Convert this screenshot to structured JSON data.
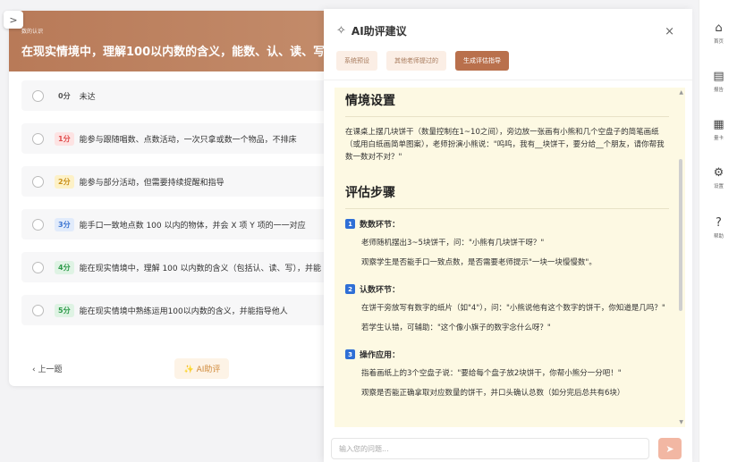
{
  "left_panel": {
    "collapse_glyph": ">",
    "breadcrumb": "数的认识",
    "title": "在现实情境中，理解100以内数的含义，能数、认、读、写",
    "options": [
      {
        "score": "0分",
        "text": "未达"
      },
      {
        "score": "1分",
        "text": "能参与跟随唱数、点数活动，一次只拿或数一个物品，不排床"
      },
      {
        "score": "2分",
        "text": "能参与部分活动，但需要持续提醒和指导"
      },
      {
        "score": "3分",
        "text": "能手口一致地点数 100 以内的物体，并会 X 项 Y 项的一一对应"
      },
      {
        "score": "4分",
        "text": "能在现实情境中，理解 100 以内数的含义（包括认、读、写），并能"
      },
      {
        "score": "5分",
        "text": "能在现实情境中熟练运用100以内数的含义，并能指导他人"
      }
    ],
    "prev_label": "上一题",
    "ai_button_label": "AI助评"
  },
  "drawer": {
    "title": "AI助评建议",
    "close_glyph": "×",
    "tabs": [
      {
        "label": "系统预设",
        "active": false
      },
      {
        "label": "其他老师提过的",
        "active": false
      },
      {
        "label": "生成评估指导",
        "active": true
      }
    ],
    "content": {
      "heading1": "情境设置",
      "scenario": "在课桌上摆几块饼干（数量控制在1~10之间），旁边放一张画有小熊和几个空盘子的简笔画纸（或用白纸画简单图案），老师扮演小熊说：\"呜呜，我有__块饼干，要分给__个朋友，请你帮我数一数对不对？\"",
      "heading2": "评估步骤",
      "steps": [
        {
          "num": "1",
          "title": "数数环节：",
          "lines": [
            "老师随机摆出3~5块饼干，问：\"小熊有几块饼干呀？\"",
            "观察学生是否能手口一致点数，是否需要老师提示\"一块一块慢慢数\"。"
          ]
        },
        {
          "num": "2",
          "title": "认数环节：",
          "lines": [
            "在饼干旁放写有数字的纸片（如\"4\"），问：\"小熊说他有这个数字的饼干，你知道是几吗？\"",
            "若学生认错，可辅助：\"这个像小旗子的数字念什么呀？\""
          ]
        },
        {
          "num": "3",
          "title": "操作应用：",
          "lines": [
            "指着画纸上的3个空盘子说：\"要给每个盘子放2块饼干，你帮小熊分一分吧！\"",
            "观察是否能正确拿取对应数量的饼干，并口头确认总数（如分完后总共有6块）"
          ]
        }
      ]
    },
    "input_placeholder": "输入您的问题...",
    "send_glyph": "➤"
  },
  "rail": [
    {
      "icon": "⌂",
      "label": "首页",
      "icon_name": "home-icon"
    },
    {
      "icon": "▤",
      "label": "报告",
      "icon_name": "report-icon"
    },
    {
      "icon": "▦",
      "label": "量卡",
      "icon_name": "card-icon"
    },
    {
      "icon": "⚙",
      "label": "设置",
      "icon_name": "gear-icon"
    },
    {
      "icon": "?",
      "label": "帮助",
      "icon_name": "help-icon"
    }
  ]
}
